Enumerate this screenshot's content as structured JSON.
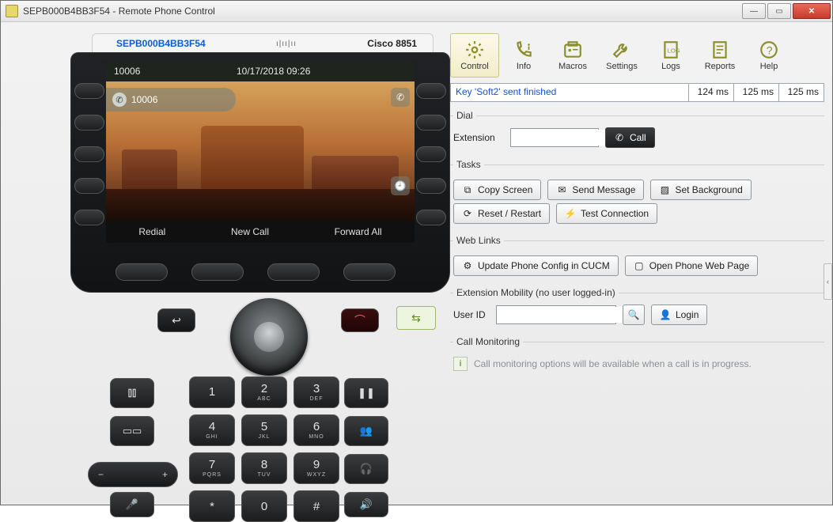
{
  "window": {
    "title": "SEPB000B4BB3F54 - Remote Phone Control"
  },
  "phone": {
    "mac": "SEPB000B4BB3F54",
    "brand": "cisco",
    "model": "Cisco 8851",
    "status_number": "10006",
    "status_datetime": "10/17/2018 09:26",
    "line_label": "10006",
    "softkeys": {
      "1": "Redial",
      "2": "New Call",
      "3": "Forward All"
    },
    "keypad": [
      {
        "d": "1",
        "s": ""
      },
      {
        "d": "2",
        "s": "ABC"
      },
      {
        "d": "3",
        "s": "DEF"
      },
      {
        "d": "4",
        "s": "GHI"
      },
      {
        "d": "5",
        "s": "JKL"
      },
      {
        "d": "6",
        "s": "MNO"
      },
      {
        "d": "7",
        "s": "PQRS"
      },
      {
        "d": "8",
        "s": "TUV"
      },
      {
        "d": "9",
        "s": "WXYZ"
      },
      {
        "d": "*",
        "s": ""
      },
      {
        "d": "0",
        "s": ""
      },
      {
        "d": "#",
        "s": ""
      }
    ]
  },
  "toolbar": {
    "control": "Control",
    "info": "Info",
    "macros": "Macros",
    "settings": "Settings",
    "logs": "Logs",
    "reports": "Reports",
    "help": "Help"
  },
  "status": {
    "message": "Key 'Soft2' sent finished",
    "t1": "124 ms",
    "t2": "125 ms",
    "t3": "125 ms"
  },
  "dial": {
    "legend": "Dial",
    "extension_label": "Extension",
    "extension_value": "",
    "call": "Call"
  },
  "tasks": {
    "legend": "Tasks",
    "copy": "Copy Screen",
    "send": "Send Message",
    "setbg": "Set Background",
    "reset": "Reset / Restart",
    "test": "Test Connection"
  },
  "weblinks": {
    "legend": "Web Links",
    "update": "Update Phone Config in CUCM",
    "open": "Open Phone Web Page"
  },
  "em": {
    "legend": "Extension Mobility (no user logged-in)",
    "userid_label": "User ID",
    "userid_value": "",
    "login": "Login"
  },
  "monitor": {
    "legend": "Call Monitoring",
    "hint": "Call monitoring options will be available when a call is in progress."
  }
}
